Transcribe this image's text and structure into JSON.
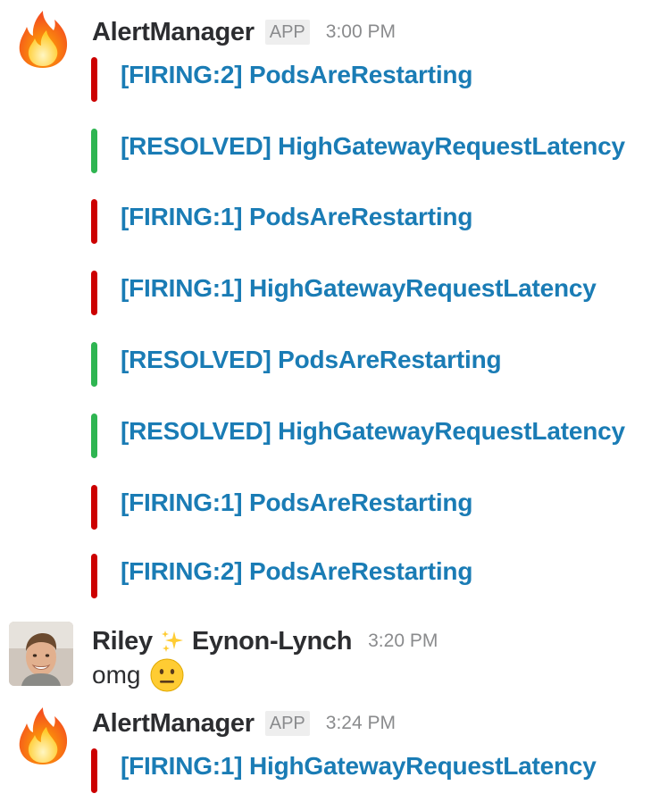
{
  "messages": [
    {
      "author": "AlertManager",
      "badge": "APP",
      "time": "3:00 PM",
      "avatar_icon": "fire-icon",
      "attachments": [
        {
          "title": "[FIRING:2] PodsAreRestarting",
          "status": "firing",
          "color": "#cc0000"
        },
        {
          "title": "[RESOLVED] HighGatewayRequestLatency",
          "status": "resolved",
          "color": "#2eb551"
        },
        {
          "title": "[FIRING:1] PodsAreRestarting",
          "status": "firing",
          "color": "#cc0000"
        },
        {
          "title": "[FIRING:1] HighGatewayRequestLatency",
          "status": "firing",
          "color": "#cc0000"
        },
        {
          "title": "[RESOLVED] PodsAreRestarting",
          "status": "resolved",
          "color": "#2eb551"
        },
        {
          "title": "[RESOLVED] HighGatewayRequestLatency",
          "status": "resolved",
          "color": "#2eb551"
        },
        {
          "title": "[FIRING:1] PodsAreRestarting",
          "status": "firing",
          "color": "#cc0000"
        },
        {
          "title": "[FIRING:2] PodsAreRestarting",
          "status": "firing",
          "color": "#cc0000"
        }
      ]
    },
    {
      "author_first": "Riley",
      "author_last": "Eynon-Lynch",
      "name_icon": "sparkles-icon",
      "time": "3:20 PM",
      "text": "omg",
      "text_emoji": "neutral-face-icon"
    },
    {
      "author": "AlertManager",
      "badge": "APP",
      "time": "3:24 PM",
      "avatar_icon": "fire-icon",
      "attachments": [
        {
          "title": "[FIRING:1] HighGatewayRequestLatency",
          "status": "firing",
          "color": "#cc0000"
        }
      ]
    }
  ],
  "colors": {
    "link": "#1a7cb5",
    "firing": "#cc0000",
    "resolved": "#2eb551",
    "meta": "#8a8b8d"
  }
}
